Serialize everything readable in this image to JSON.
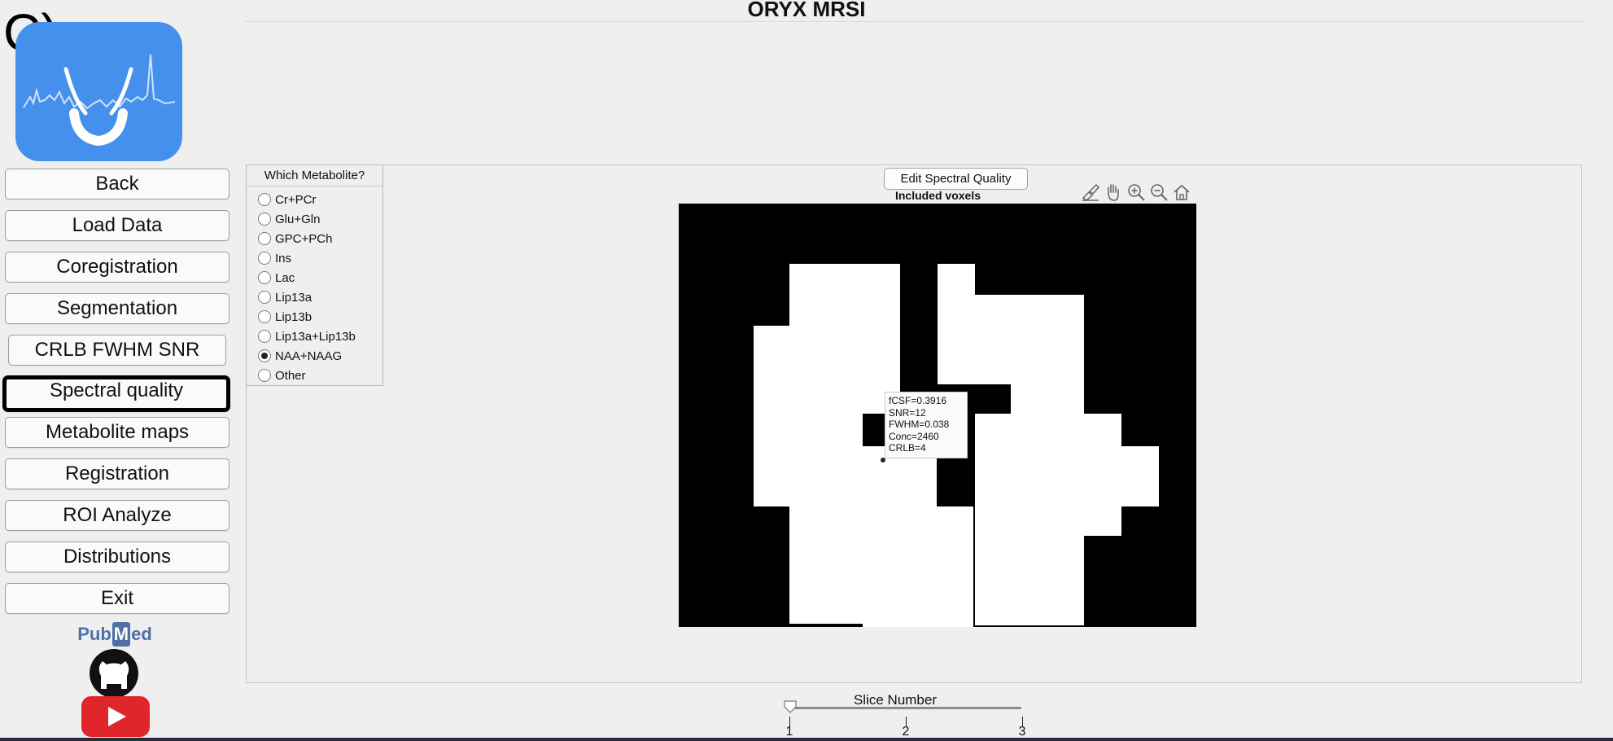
{
  "panel_label": "C)",
  "app": {
    "title": "ORYX MRSI"
  },
  "logo": {
    "icon": "oryx-spectrum-logo-icon",
    "color": "#4590ec"
  },
  "nav": {
    "buttons": [
      {
        "label": "Back"
      },
      {
        "label": "Load Data"
      },
      {
        "label": "Coregistration"
      },
      {
        "label": "Segmentation"
      },
      {
        "label": "CRLB FWHM SNR"
      },
      {
        "label": "Spectral quality",
        "active": true
      },
      {
        "label": "Metabolite maps"
      },
      {
        "label": "Registration"
      },
      {
        "label": "ROI Analyze"
      },
      {
        "label": "Distributions"
      },
      {
        "label": "Exit"
      }
    ]
  },
  "links": {
    "pubmed_pre": "Pub",
    "pubmed_m": "M",
    "pubmed_post": "ed",
    "github_icon": "github-icon",
    "youtube_icon": "youtube-icon"
  },
  "metabolite_group": {
    "title": "Which Metabolite?",
    "options": [
      "Cr+PCr",
      "Glu+Gln",
      "GPC+PCh",
      "Ins",
      "Lac",
      "Lip13a",
      "Lip13b",
      "Lip13a+Lip13b",
      "NAA+NAAG",
      "Other"
    ],
    "selected": "NAA+NAAG"
  },
  "figure": {
    "edit_button": "Edit Spectral Quality",
    "title": "Included voxels",
    "toolbar_icons": [
      "brush-icon",
      "pan-hand-icon",
      "zoom-in-icon",
      "zoom-out-icon",
      "home-icon"
    ],
    "datatip": [
      "fCSF=0.3916",
      "SNR=12",
      "FWHM=0.038",
      "Conc=2460",
      "CRLB=4"
    ]
  },
  "slider": {
    "label": "Slice Number",
    "ticks": [
      "1",
      "2",
      "3"
    ],
    "value": 1
  }
}
